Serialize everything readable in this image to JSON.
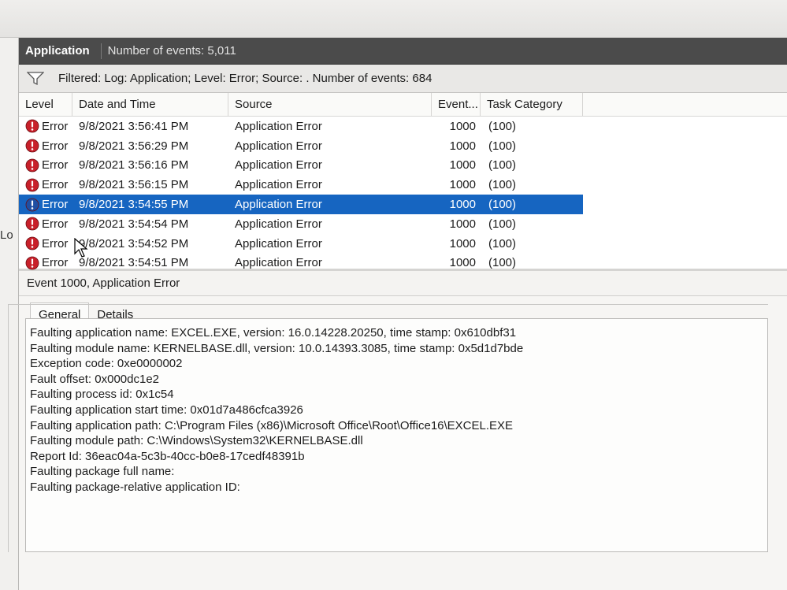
{
  "left_pane": {
    "label": "Lo"
  },
  "header": {
    "title": "Application",
    "count_text": "Number of events: 5,011"
  },
  "filter": {
    "text": "Filtered: Log: Application; Level: Error; Source: . Number of events: 684"
  },
  "columns": {
    "level": "Level",
    "date": "Date and Time",
    "source": "Source",
    "event": "Event...",
    "task": "Task Category"
  },
  "events": [
    {
      "level": "Error",
      "date": "9/8/2021 3:56:41 PM",
      "source": "Application Error",
      "event_id": "1000",
      "task": "(100)"
    },
    {
      "level": "Error",
      "date": "9/8/2021 3:56:29 PM",
      "source": "Application Error",
      "event_id": "1000",
      "task": "(100)"
    },
    {
      "level": "Error",
      "date": "9/8/2021 3:56:16 PM",
      "source": "Application Error",
      "event_id": "1000",
      "task": "(100)"
    },
    {
      "level": "Error",
      "date": "9/8/2021 3:56:15 PM",
      "source": "Application Error",
      "event_id": "1000",
      "task": "(100)"
    },
    {
      "level": "Error",
      "date": "9/8/2021 3:54:55 PM",
      "source": "Application Error",
      "event_id": "1000",
      "task": "(100)"
    },
    {
      "level": "Error",
      "date": "9/8/2021 3:54:54 PM",
      "source": "Application Error",
      "event_id": "1000",
      "task": "(100)"
    },
    {
      "level": "Error",
      "date": "9/8/2021 3:54:52 PM",
      "source": "Application Error",
      "event_id": "1000",
      "task": "(100)"
    },
    {
      "level": "Error",
      "date": "9/8/2021 3:54:51 PM",
      "source": "Application Error",
      "event_id": "1000",
      "task": "(100)"
    }
  ],
  "selected_row": 4,
  "detail": {
    "title": "Event 1000, Application Error",
    "tabs": [
      "General",
      "Details"
    ],
    "lines": [
      "Faulting application name: EXCEL.EXE, version: 16.0.14228.20250, time stamp: 0x610dbf31",
      "Faulting module name: KERNELBASE.dll, version: 10.0.14393.3085, time stamp: 0x5d1d7bde",
      "Exception code: 0xe0000002",
      "Fault offset: 0x000dc1e2",
      "Faulting process id: 0x1c54",
      "Faulting application start time: 0x01d7a486cfca3926",
      "Faulting application path: C:\\Program Files (x86)\\Microsoft Office\\Root\\Office16\\EXCEL.EXE",
      "Faulting module path: C:\\Windows\\System32\\KERNELBASE.dll",
      "Report Id: 36eac04a-5c3b-40cc-b0e8-17cedf48391b",
      "Faulting package full name:",
      "Faulting package-relative application ID:"
    ]
  },
  "icons": {
    "error": "error-circle-icon",
    "filter": "funnel-icon"
  },
  "colors": {
    "selection": "#1665c1",
    "error_red": "#c8202a",
    "header_bar": "#4b4b4b"
  }
}
